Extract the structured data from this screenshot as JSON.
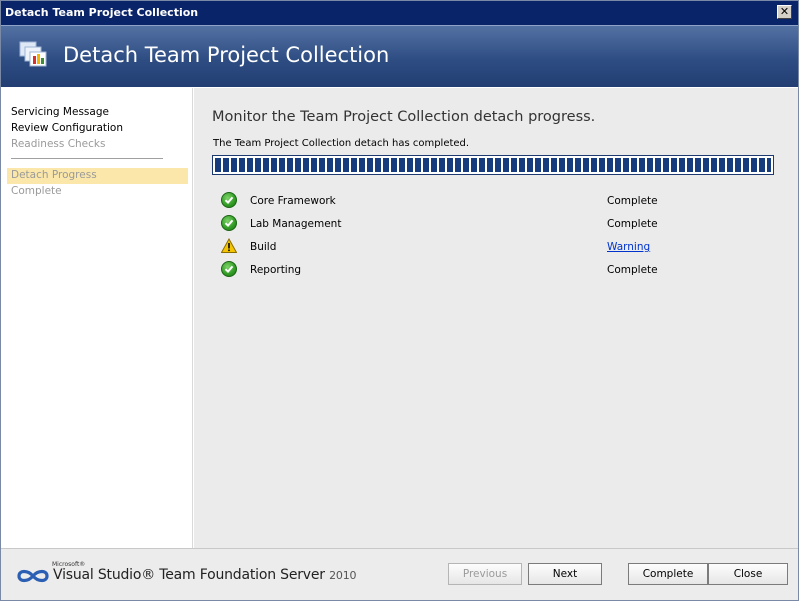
{
  "window": {
    "title": "Detach Team Project Collection",
    "close_glyph": "✕"
  },
  "banner": {
    "heading": "Detach Team Project Collection",
    "logo_icon": "team-project-collection-icon"
  },
  "nav": {
    "items": [
      {
        "label": "Servicing Message",
        "state": "done"
      },
      {
        "label": "Review Configuration",
        "state": "done"
      },
      {
        "label": "Readiness Checks",
        "state": "dim"
      },
      {
        "label": "Detach Progress",
        "state": "active"
      },
      {
        "label": "Complete",
        "state": "dim"
      }
    ]
  },
  "main": {
    "heading": "Monitor the Team Project Collection detach progress.",
    "status": "The Team Project Collection detach has completed.",
    "progress_percent": 100,
    "tasks": [
      {
        "name": "Core Framework",
        "result": "Complete",
        "icon": "success-check-icon"
      },
      {
        "name": "Lab Management",
        "result": "Complete",
        "icon": "success-check-icon"
      },
      {
        "name": "Build",
        "result": "Warning",
        "icon": "warning-icon"
      },
      {
        "name": "Reporting",
        "result": "Complete",
        "icon": "success-check-icon"
      }
    ]
  },
  "footer": {
    "brand_small": "Microsoft®",
    "brand_name": "Visual Studio® Team Foundation Server",
    "brand_version": "2010",
    "buttons": {
      "previous": "Previous",
      "next": "Next",
      "complete": "Complete",
      "close": "Close"
    }
  },
  "colors": {
    "title_bar": "#0a246a",
    "banner": "#2e4d83",
    "active_nav": "#fbe7a9",
    "progress_fill": "#173c7e",
    "success": "#2f9a23",
    "warning": "#f5c400",
    "link": "#0033cc"
  }
}
